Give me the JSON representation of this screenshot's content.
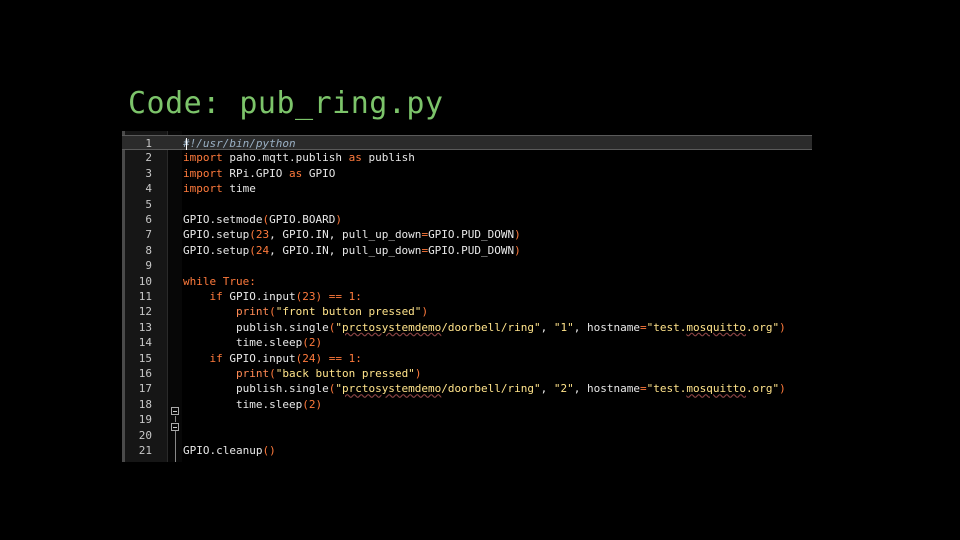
{
  "slide": {
    "title": "Code: pub_ring.py"
  },
  "editor": {
    "current_line": 1,
    "lines": [
      {
        "n": "1",
        "tokens": [
          {
            "t": "#!/usr/bin/python",
            "c": "cm"
          }
        ]
      },
      {
        "n": "2",
        "tokens": [
          {
            "t": "import",
            "c": "kw"
          },
          {
            "t": " paho.mqtt.publish ",
            "c": "id"
          },
          {
            "t": "as",
            "c": "kw"
          },
          {
            "t": " publish",
            "c": "id"
          }
        ]
      },
      {
        "n": "3",
        "tokens": [
          {
            "t": "import",
            "c": "kw"
          },
          {
            "t": " RPi.GPIO ",
            "c": "id"
          },
          {
            "t": "as",
            "c": "kw"
          },
          {
            "t": " GPIO",
            "c": "id"
          }
        ]
      },
      {
        "n": "4",
        "tokens": [
          {
            "t": "import",
            "c": "kw"
          },
          {
            "t": " time",
            "c": "id"
          }
        ]
      },
      {
        "n": "5",
        "tokens": []
      },
      {
        "n": "6",
        "tokens": [
          {
            "t": "GPIO.setmode",
            "c": "id"
          },
          {
            "t": "(",
            "c": "op"
          },
          {
            "t": "GPIO.BOARD",
            "c": "id"
          },
          {
            "t": ")",
            "c": "op"
          }
        ]
      },
      {
        "n": "7",
        "tokens": [
          {
            "t": "GPIO.setup",
            "c": "id"
          },
          {
            "t": "(",
            "c": "op"
          },
          {
            "t": "23",
            "c": "num"
          },
          {
            "t": ", GPIO.IN, pull_up_down",
            "c": "id"
          },
          {
            "t": "=",
            "c": "op"
          },
          {
            "t": "GPIO.PUD_DOWN",
            "c": "id"
          },
          {
            "t": ")",
            "c": "op"
          }
        ]
      },
      {
        "n": "8",
        "tokens": [
          {
            "t": "GPIO.setup",
            "c": "id"
          },
          {
            "t": "(",
            "c": "op"
          },
          {
            "t": "24",
            "c": "num"
          },
          {
            "t": ", GPIO.IN, pull_up_down",
            "c": "id"
          },
          {
            "t": "=",
            "c": "op"
          },
          {
            "t": "GPIO.PUD_DOWN",
            "c": "id"
          },
          {
            "t": ")",
            "c": "op"
          }
        ]
      },
      {
        "n": "9",
        "tokens": []
      },
      {
        "n": "10",
        "tokens": [
          {
            "t": "while",
            "c": "kw"
          },
          {
            "t": " ",
            "c": "id"
          },
          {
            "t": "True",
            "c": "kw"
          },
          {
            "t": ":",
            "c": "op"
          }
        ]
      },
      {
        "n": "11",
        "tokens": [
          {
            "t": "    ",
            "c": "id"
          },
          {
            "t": "if",
            "c": "kw"
          },
          {
            "t": " GPIO.input",
            "c": "id"
          },
          {
            "t": "(",
            "c": "op"
          },
          {
            "t": "23",
            "c": "num"
          },
          {
            "t": ")",
            "c": "op"
          },
          {
            "t": " == ",
            "c": "op"
          },
          {
            "t": "1",
            "c": "num"
          },
          {
            "t": ":",
            "c": "op"
          }
        ]
      },
      {
        "n": "12",
        "tokens": [
          {
            "t": "        ",
            "c": "id"
          },
          {
            "t": "print",
            "c": "fn"
          },
          {
            "t": "(",
            "c": "op"
          },
          {
            "t": "\"front button pressed\"",
            "c": "str"
          },
          {
            "t": ")",
            "c": "op"
          }
        ]
      },
      {
        "n": "13",
        "tokens": [
          {
            "t": "        publish.single",
            "c": "id"
          },
          {
            "t": "(",
            "c": "op"
          },
          {
            "t": "\"",
            "c": "str"
          },
          {
            "t": "prctosystemdemo",
            "c": "str sq"
          },
          {
            "t": "/doorbell/ring\"",
            "c": "str"
          },
          {
            "t": ", ",
            "c": "id"
          },
          {
            "t": "\"1\"",
            "c": "str"
          },
          {
            "t": ", hostname",
            "c": "id"
          },
          {
            "t": "=",
            "c": "op"
          },
          {
            "t": "\"test.",
            "c": "str"
          },
          {
            "t": "mosquitto",
            "c": "str sq"
          },
          {
            "t": ".org\"",
            "c": "str"
          },
          {
            "t": ")",
            "c": "op"
          }
        ]
      },
      {
        "n": "14",
        "tokens": [
          {
            "t": "        time.sleep",
            "c": "id"
          },
          {
            "t": "(",
            "c": "op"
          },
          {
            "t": "2",
            "c": "num"
          },
          {
            "t": ")",
            "c": "op"
          }
        ]
      },
      {
        "n": "15",
        "tokens": [
          {
            "t": "    ",
            "c": "id"
          },
          {
            "t": "if",
            "c": "kw"
          },
          {
            "t": " GPIO.input",
            "c": "id"
          },
          {
            "t": "(",
            "c": "op"
          },
          {
            "t": "24",
            "c": "num"
          },
          {
            "t": ")",
            "c": "op"
          },
          {
            "t": " == ",
            "c": "op"
          },
          {
            "t": "1",
            "c": "num"
          },
          {
            "t": ":",
            "c": "op"
          }
        ]
      },
      {
        "n": "16",
        "tokens": [
          {
            "t": "        ",
            "c": "id"
          },
          {
            "t": "print",
            "c": "fn"
          },
          {
            "t": "(",
            "c": "op"
          },
          {
            "t": "\"back button pressed\"",
            "c": "str"
          },
          {
            "t": ")",
            "c": "op"
          }
        ]
      },
      {
        "n": "17",
        "tokens": [
          {
            "t": "        publish.single",
            "c": "id"
          },
          {
            "t": "(",
            "c": "op"
          },
          {
            "t": "\"",
            "c": "str"
          },
          {
            "t": "prctosystemdemo",
            "c": "str sq"
          },
          {
            "t": "/doorbell/ring\"",
            "c": "str"
          },
          {
            "t": ", ",
            "c": "id"
          },
          {
            "t": "\"2\"",
            "c": "str"
          },
          {
            "t": ", hostname",
            "c": "id"
          },
          {
            "t": "=",
            "c": "op"
          },
          {
            "t": "\"test.",
            "c": "str"
          },
          {
            "t": "mosquitto",
            "c": "str sq"
          },
          {
            "t": ".org\"",
            "c": "str"
          },
          {
            "t": ")",
            "c": "op"
          }
        ]
      },
      {
        "n": "18",
        "tokens": [
          {
            "t": "        time.sleep",
            "c": "id"
          },
          {
            "t": "(",
            "c": "op"
          },
          {
            "t": "2",
            "c": "num"
          },
          {
            "t": ")",
            "c": "op"
          }
        ]
      },
      {
        "n": "19",
        "tokens": []
      },
      {
        "n": "20",
        "tokens": []
      },
      {
        "n": "21",
        "tokens": [
          {
            "t": "GPIO.cleanup",
            "c": "id"
          },
          {
            "t": "()",
            "c": "op"
          }
        ]
      }
    ]
  }
}
